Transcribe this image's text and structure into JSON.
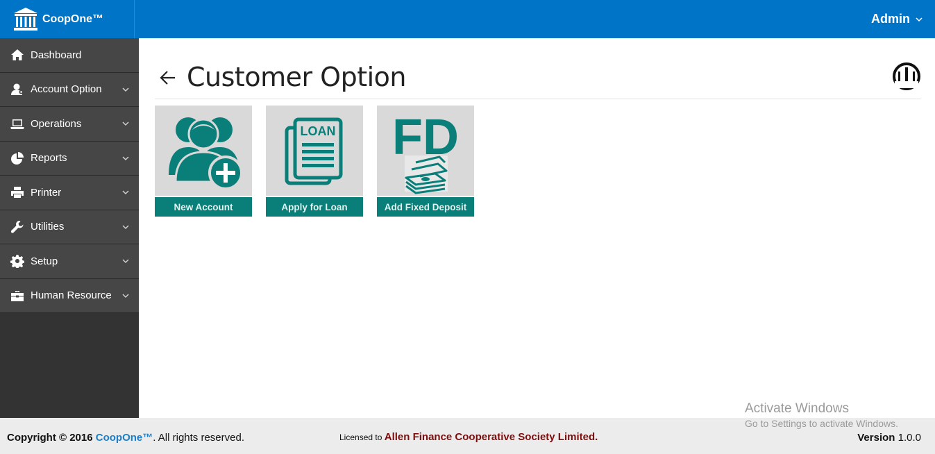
{
  "app": {
    "name": "CoopOne™"
  },
  "header": {
    "user": "Admin"
  },
  "sidebar": {
    "items": [
      {
        "label": "Dashboard",
        "icon": "home-icon"
      },
      {
        "label": "Account Option",
        "icon": "user-icon"
      },
      {
        "label": "Operations",
        "icon": "laptop-icon"
      },
      {
        "label": "Reports",
        "icon": "pie-chart-icon"
      },
      {
        "label": "Printer",
        "icon": "printer-icon"
      },
      {
        "label": "Utilities",
        "icon": "wrench-icon"
      },
      {
        "label": "Setup",
        "icon": "gear-icon"
      },
      {
        "label": "Human Resource",
        "icon": "briefcase-icon"
      }
    ]
  },
  "page": {
    "title": "Customer Option"
  },
  "tiles": [
    {
      "label": "New Account"
    },
    {
      "label": "Apply for Loan",
      "art_text": "LOAN"
    },
    {
      "label": "Add Fixed Deposit",
      "art_text": "FD"
    }
  ],
  "footer": {
    "copyright_prefix": "Copyright © 2016",
    "copyright_brand": "CoopOne™",
    "copyright_suffix": ". All rights reserved.",
    "licensed_prefix": "Licensed to",
    "licensed_org": "Allen Finance Cooperative Society Limited",
    "licensed_suffix": ".",
    "version_label": "Version",
    "version_value": "1.0.0"
  },
  "watermark": {
    "line1": "Activate Windows",
    "line2": "Go to Settings to activate Windows."
  },
  "colors": {
    "header": "#0074c7",
    "sidebar": "#464646",
    "tile_accent": "#0a7e78",
    "tile_bg": "#d9d9d9",
    "licensed_org": "#7b0d0d",
    "brand_link": "#1a7fc8"
  }
}
